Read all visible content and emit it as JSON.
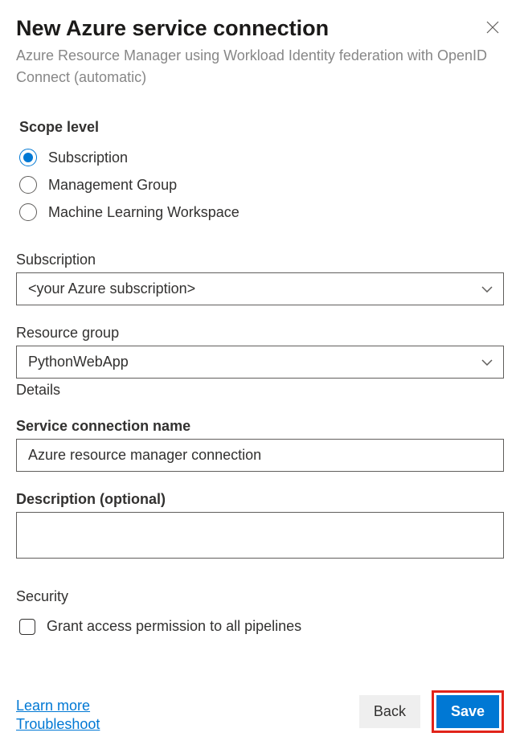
{
  "header": {
    "title": "New Azure service connection",
    "subtitle": "Azure Resource Manager using Workload Identity federation with OpenID Connect (automatic)"
  },
  "scope": {
    "label": "Scope level",
    "options": [
      {
        "label": "Subscription",
        "selected": true
      },
      {
        "label": "Management Group",
        "selected": false
      },
      {
        "label": "Machine Learning Workspace",
        "selected": false
      }
    ]
  },
  "subscription": {
    "label": "Subscription",
    "value": "<your Azure subscription>"
  },
  "resource_group": {
    "label": "Resource group",
    "value": "PythonWebApp"
  },
  "details_label": "Details",
  "connection_name": {
    "label": "Service connection name",
    "value": "Azure resource manager connection"
  },
  "description": {
    "label": "Description (optional)",
    "value": ""
  },
  "security": {
    "heading": "Security",
    "checkbox_label": "Grant access permission to all pipelines"
  },
  "links": {
    "learn_more": "Learn more",
    "troubleshoot": "Troubleshoot"
  },
  "buttons": {
    "back": "Back",
    "save": "Save"
  }
}
